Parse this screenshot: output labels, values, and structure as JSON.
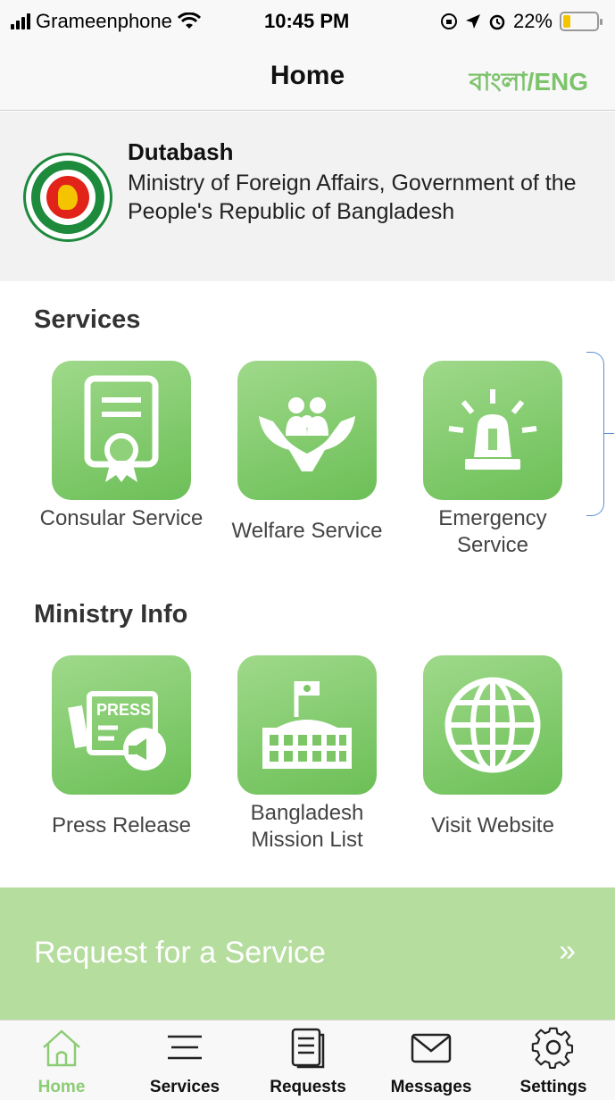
{
  "status_bar": {
    "carrier": "Grameenphone",
    "time": "10:45 PM",
    "battery": "22%",
    "battery_level": 0.22,
    "battery_color": "#f5c400"
  },
  "nav": {
    "title": "Home",
    "language_toggle": "বাংলা/ENG",
    "accent_color": "#7cc36b"
  },
  "header": {
    "emblem_icon": "bangladesh-government-seal",
    "name": "Dutabash",
    "description": "Ministry of Foreign Affairs, Government of the People's Republic of Bangladesh"
  },
  "services": {
    "title": "Services",
    "items": [
      {
        "label": "Consular Service",
        "icon": "certificate-icon"
      },
      {
        "label": "Welfare Service",
        "icon": "family-care-icon"
      },
      {
        "label": "Emergency Service",
        "icon": "siren-icon"
      }
    ]
  },
  "ministry_info": {
    "title": "Ministry Info",
    "items": [
      {
        "label": "Press Release",
        "icon": "press-icon",
        "badge": "PRESS"
      },
      {
        "label": "Bangladesh Mission List",
        "icon": "embassy-building-icon"
      },
      {
        "label": "Visit Website",
        "icon": "globe-icon"
      }
    ]
  },
  "request_banner": {
    "label": "Request for a Service",
    "arrow": "»",
    "color": "#b5dd9e"
  },
  "tab_bar": {
    "items": [
      {
        "label": "Home",
        "icon": "home-icon",
        "active": true
      },
      {
        "label": "Services",
        "icon": "menu-icon",
        "active": false
      },
      {
        "label": "Requests",
        "icon": "document-icon",
        "active": false
      },
      {
        "label": "Messages",
        "icon": "envelope-icon",
        "active": false
      },
      {
        "label": "Settings",
        "icon": "gear-icon",
        "active": false
      }
    ],
    "active_color": "#8ccc74"
  }
}
